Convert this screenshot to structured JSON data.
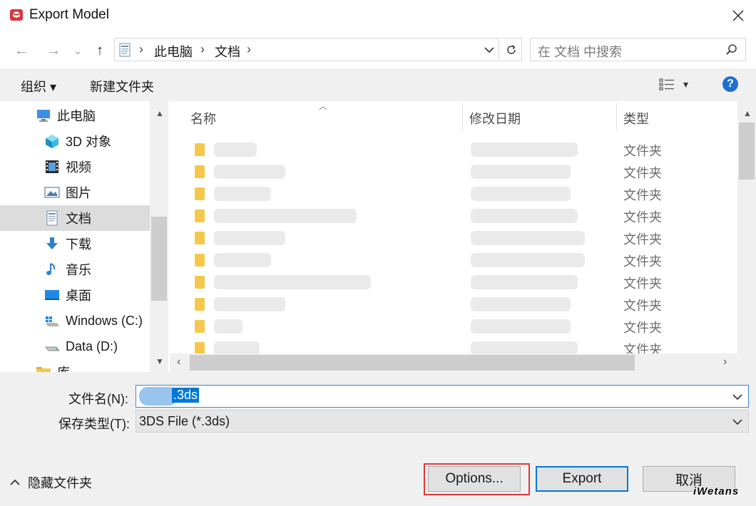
{
  "window": {
    "title": "Export Model",
    "close_glyph": "✕"
  },
  "nav": {
    "back": "←",
    "forward": "→",
    "history": "⌄",
    "up": "↑",
    "breadcrumb": [
      "此电脑",
      "文档"
    ],
    "search_placeholder": "在 文档 中搜索"
  },
  "toolbar": {
    "organize": "组织 ▾",
    "new_folder": "新建文件夹",
    "view_arrow": "▾",
    "help": "?"
  },
  "sidebar": {
    "items": [
      {
        "label": "此电脑",
        "icon": "computer-icon",
        "selected": false,
        "indent": 1
      },
      {
        "label": "3D 对象",
        "icon": "cube-icon",
        "selected": false,
        "indent": 2
      },
      {
        "label": "视频",
        "icon": "video-icon",
        "selected": false,
        "indent": 2
      },
      {
        "label": "图片",
        "icon": "picture-icon",
        "selected": false,
        "indent": 2
      },
      {
        "label": "文档",
        "icon": "document-icon",
        "selected": true,
        "indent": 2
      },
      {
        "label": "下载",
        "icon": "download-icon",
        "selected": false,
        "indent": 2
      },
      {
        "label": "音乐",
        "icon": "music-icon",
        "selected": false,
        "indent": 2
      },
      {
        "label": "桌面",
        "icon": "desktop-icon",
        "selected": false,
        "indent": 2
      },
      {
        "label": "Windows (C:)",
        "icon": "windows-drive-icon",
        "selected": false,
        "indent": 2
      },
      {
        "label": "Data (D:)",
        "icon": "drive-icon",
        "selected": false,
        "indent": 2
      },
      {
        "label": "库",
        "icon": "library-icon",
        "selected": false,
        "indent": 1
      }
    ]
  },
  "file_list": {
    "columns": {
      "name": "名称",
      "modified": "修改日期",
      "type": "类型"
    },
    "rows": [
      {
        "type": "文件夹"
      },
      {
        "type": "文件夹"
      },
      {
        "type": "文件夹"
      },
      {
        "type": "文件夹"
      },
      {
        "type": "文件夹"
      },
      {
        "type": "文件夹"
      },
      {
        "type": "文件夹"
      },
      {
        "type": "文件夹"
      },
      {
        "type": "文件夹"
      },
      {
        "type": "文件夹"
      }
    ]
  },
  "form": {
    "filename_label": "文件名(N):",
    "filename_value": ".3ds",
    "filetype_label": "保存类型(T):",
    "filetype_value": "3DS File (*.3ds)"
  },
  "footer": {
    "hide_folders": "隐藏文件夹",
    "options": "Options...",
    "export": "Export",
    "cancel": "取消"
  },
  "watermark": "iWetans",
  "colors": {
    "accent": "#0078d7",
    "highlight_box": "#e0393a",
    "folder": "#f5c84c"
  }
}
